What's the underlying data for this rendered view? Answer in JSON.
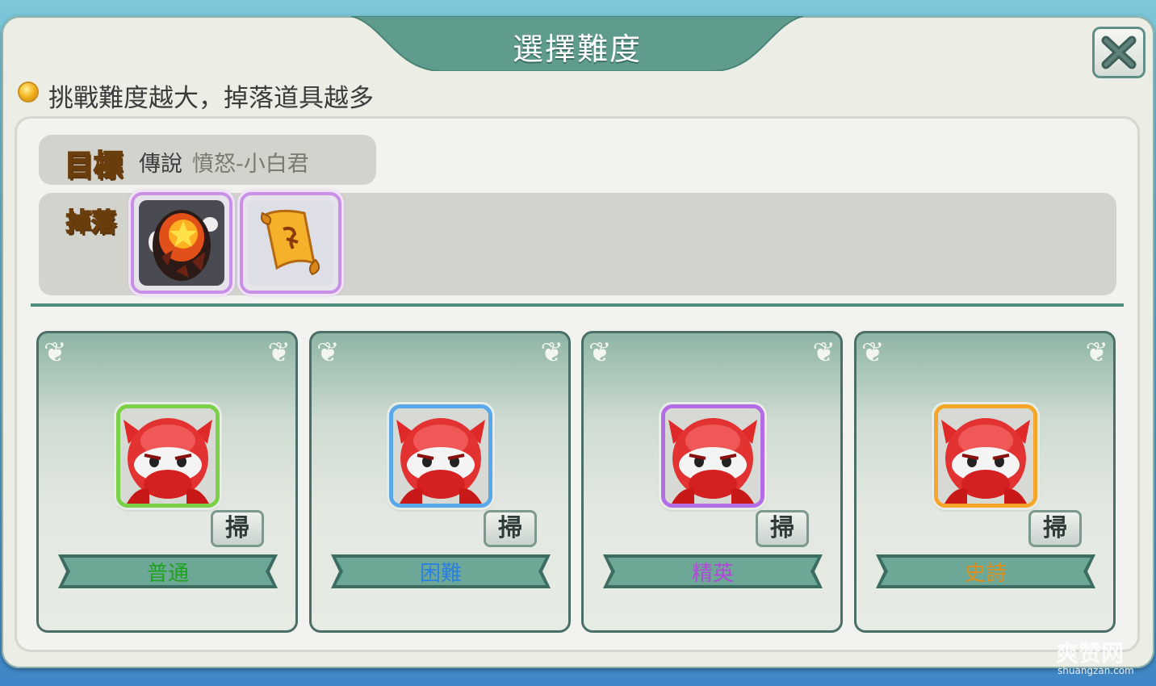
{
  "dialog": {
    "title": "選擇難度",
    "hint": "挑戰難度越大，掉落道具越多"
  },
  "target": {
    "badge": "目標",
    "prefix": "傳說",
    "name": "憤怒-小白君"
  },
  "drops": {
    "badge": "掉落",
    "items": [
      {
        "name": "lava-egg-icon"
      },
      {
        "name": "scroll-icon"
      }
    ]
  },
  "difficulties": [
    {
      "label": "普通",
      "sweep_label": "掃",
      "color": "#1fa31f",
      "frame_color": "#7ad148"
    },
    {
      "label": "困難",
      "sweep_label": "掃",
      "color": "#2a7fe0",
      "frame_color": "#5aa8ea"
    },
    {
      "label": "精英",
      "sweep_label": "掃",
      "color": "#b04ad8",
      "frame_color": "#b46be6"
    },
    {
      "label": "史詩",
      "sweep_label": "掃",
      "color": "#e0901a",
      "frame_color": "#f5a52a"
    }
  ],
  "watermark": {
    "logo": "爽赞网",
    "url": "shuangzan.com"
  }
}
